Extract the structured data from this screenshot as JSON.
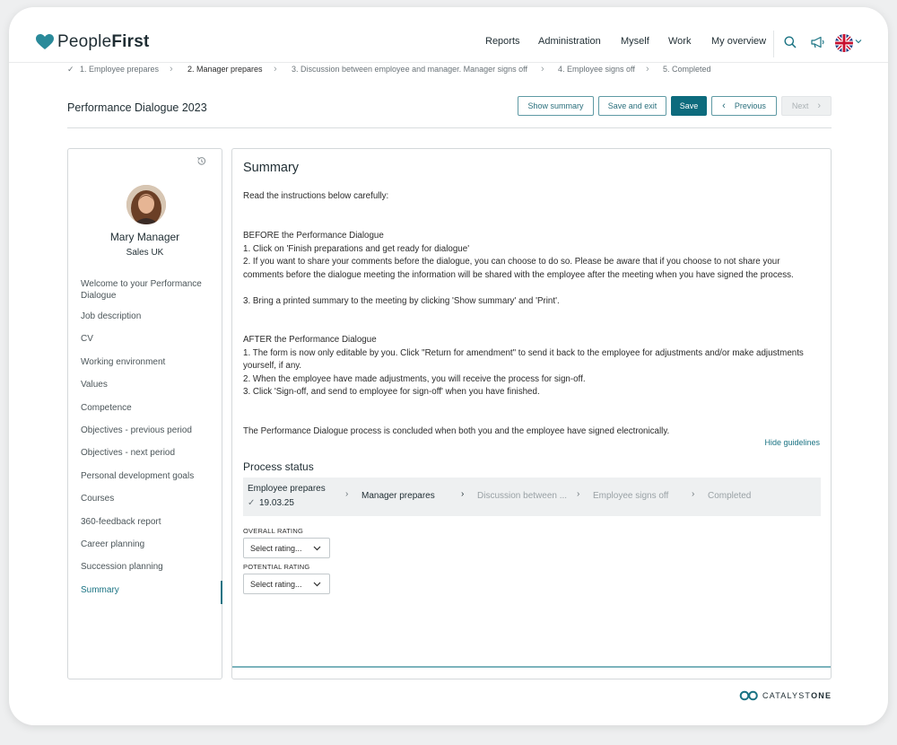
{
  "header": {
    "logo_plain": "People",
    "logo_bold": "First",
    "nav": [
      "Reports",
      "Administration",
      "Myself",
      "Work",
      "My overview"
    ]
  },
  "stepper": {
    "steps": [
      {
        "label": "1.  Employee prepares",
        "state": "done"
      },
      {
        "label": "2.  Manager prepares",
        "state": "active"
      },
      {
        "label": "3.  Discussion between employee and manager. Manager signs off",
        "state": "future"
      },
      {
        "label": "4.  Employee signs off",
        "state": "future"
      },
      {
        "label": "5.  Completed",
        "state": "future"
      }
    ],
    "done_mark": "✓"
  },
  "title_row": {
    "title": "Performance Dialogue 2023",
    "show_summary": "Show summary",
    "save_exit": "Save and exit",
    "save": "Save",
    "previous": "Previous",
    "next": "Next"
  },
  "profile": {
    "name": "Mary Manager",
    "department": "Sales UK"
  },
  "menu": {
    "items": [
      "Welcome to your Performance Dialogue",
      "Job description",
      "CV",
      "Working environment",
      "Values",
      "Competence",
      "Objectives - previous period",
      "Objectives - next period",
      "Personal development goals",
      "Courses",
      "360-feedback report",
      "Career planning",
      "Succession planning",
      "Summary"
    ],
    "active_index": 13
  },
  "summary": {
    "title": "Summary",
    "intro": "Read the instructions below carefully:",
    "before_heading": "BEFORE the Performance Dialogue",
    "before_1": "1. Click on 'Finish preparations and get ready for dialogue'",
    "before_2": "2. If you want to share your comments before the dialogue, you can choose to do so. Please be aware that if you choose to not share your comments before the dialogue meeting the information will be shared with the employee after the meeting when you have signed the process.",
    "before_3": "3. Bring a printed summary to the meeting by clicking 'Show summary' and 'Print'.",
    "after_heading": "AFTER the Performance Dialogue",
    "after_1": "1. The form is now only editable by you. Click \"Return for amendment\" to send it back to the employee for adjustments and/or make adjustments yourself, if any.",
    "after_2": "2. When the employee have made adjustments, you will receive the process for sign-off.",
    "after_3": "3. Click 'Sign-off, and send to employee for sign-off' when you have finished.",
    "conclusion": "The Performance Dialogue process is concluded when both you and the employee have signed electronically.",
    "hide_guidelines": "Hide guidelines"
  },
  "process_status": {
    "title": "Process status",
    "steps": [
      {
        "label": "Employee prepares",
        "date": "19.03.25",
        "state": "done"
      },
      {
        "label": "Manager prepares",
        "state": "current"
      },
      {
        "label": "Discussion between ...",
        "state": "future"
      },
      {
        "label": "Employee signs off",
        "state": "future"
      },
      {
        "label": "Completed",
        "state": "future"
      }
    ]
  },
  "ratings": {
    "overall_label": "OVERALL RATING",
    "overall_value": "Select rating...",
    "potential_label": "POTENTIAL RATING",
    "potential_value": "Select rating..."
  },
  "footer": {
    "brand_plain": "CATALYST",
    "brand_bold": "ONE"
  },
  "colors": {
    "accent": "#0d6b7d",
    "logo_heart": "#2a8a9a"
  }
}
